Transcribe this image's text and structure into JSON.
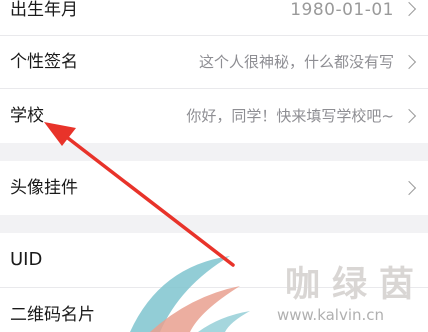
{
  "rows": {
    "birth": {
      "label": "出生年月",
      "value": "1980-01-01"
    },
    "signature": {
      "label": "个性签名",
      "value": "这个人很神秘，什么都没有写"
    },
    "school": {
      "label": "学校",
      "value": "你好，同学！快来填写学校吧~"
    },
    "pendant": {
      "label": "头像挂件"
    },
    "uid": {
      "label": "UID"
    },
    "qr": {
      "label": "二维码名片"
    }
  },
  "annotation": {
    "arrow_color": "#e8332a"
  },
  "watermark": {
    "brand": "咖绿茵",
    "url": "www.kalvin.cn"
  }
}
